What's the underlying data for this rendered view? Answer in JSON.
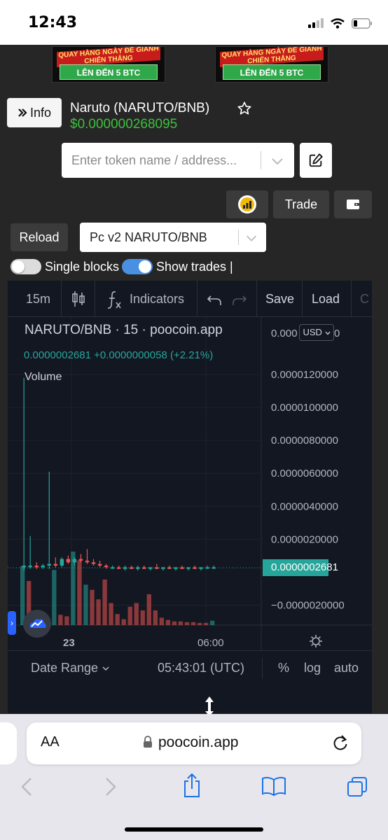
{
  "status_bar": {
    "time": "12:43"
  },
  "banners": [
    {
      "top_text": "QUAY HÀNG NGÀY ĐỂ GIÀNH CHIẾN THẮNG",
      "bottom_text": "LÊN ĐẾN 5 BTC"
    },
    {
      "top_text": "QUAY HÀNG NGÀY ĐỂ GIÀNH CHIẾN THẮNG",
      "bottom_text": "LÊN ĐẾN 5 BTC"
    }
  ],
  "header": {
    "info_label": "Info",
    "token_title": "Naruto (NARUTO/BNB)",
    "token_price": "$0.000000268095"
  },
  "search": {
    "placeholder": "Enter token name / address..."
  },
  "actions": {
    "trade_label": "Trade",
    "reload_label": "Reload"
  },
  "pair_select": {
    "value": "Pc v2 NARUTO/BNB"
  },
  "toggles": [
    {
      "label": "Single blocks",
      "on": false
    },
    {
      "label": "Show trades |",
      "on": true
    }
  ],
  "chart_toolbar": {
    "interval": "15m",
    "indicators_label": "Indicators",
    "save_label": "Save",
    "load_label": "Load",
    "overflow_label": "C"
  },
  "chart_legend": {
    "title": "NARUTO/BNB · 15 · poocoin.app",
    "ohlc": "0.0000002681  +0.0000000058 (+2.21%)",
    "volume_label": "Volume",
    "currency": "USD",
    "last_price_tag": "0.0000002681"
  },
  "chart_footer": {
    "date_range": "Date Range",
    "time": "05:43:01 (UTC)",
    "percent": "%",
    "log": "log",
    "auto": "auto"
  },
  "browser": {
    "aa_label": "AA",
    "url": "poocoin.app"
  },
  "colors": {
    "up": "#26a69a",
    "down": "#ef5350",
    "price_green": "#3fbf3f",
    "chart_bg": "#131722",
    "toggle_on": "#4a90e2"
  },
  "chart_data": {
    "type": "candlestick",
    "x_tick_labels": [
      "23",
      "06:00"
    ],
    "y_tick_labels": [
      "0.0000120000",
      "0.0000100000",
      "0.0000080000",
      "0.0000060000",
      "0.0000040000",
      "0.0000020000",
      "−0.0000020000"
    ],
    "y_top_label": "0.000",
    "y_top_suffix": "0",
    "ylim": [
      -3e-06,
      1.4e-05
    ],
    "last_price": 2.681e-07,
    "candles": [
      {
        "o": 4e-07,
        "h": 1.18e-05,
        "l": 1e-07,
        "c": 3e-07,
        "up": true
      },
      {
        "o": 3e-07,
        "h": 2.2e-06,
        "l": 2e-07,
        "c": 4e-07,
        "up": true
      },
      {
        "o": 4e-07,
        "h": 6e-07,
        "l": 2e-07,
        "c": 3e-07,
        "up": false
      },
      {
        "o": 3e-07,
        "h": 5e-07,
        "l": 2e-07,
        "c": 4e-07,
        "up": true
      },
      {
        "o": 4e-07,
        "h": 6.1e-06,
        "l": 2e-07,
        "c": 5e-07,
        "up": true
      },
      {
        "o": 5e-07,
        "h": 9e-07,
        "l": 3e-07,
        "c": 4e-07,
        "up": false
      },
      {
        "o": 4e-07,
        "h": 9e-07,
        "l": 3e-07,
        "c": 8e-07,
        "up": true
      },
      {
        "o": 8e-07,
        "h": 1e-06,
        "l": 5e-07,
        "c": 6e-07,
        "up": false
      },
      {
        "o": 6e-07,
        "h": 9e-07,
        "l": 4e-07,
        "c": 8e-07,
        "up": true
      },
      {
        "o": 8e-07,
        "h": 1.1e-06,
        "l": 6e-07,
        "c": 7e-07,
        "up": false
      },
      {
        "o": 7e-07,
        "h": 1.4e-06,
        "l": 5e-07,
        "c": 6e-07,
        "up": false
      },
      {
        "o": 6e-07,
        "h": 8e-07,
        "l": 4e-07,
        "c": 5e-07,
        "up": false
      },
      {
        "o": 5e-07,
        "h": 7e-07,
        "l": 3e-07,
        "c": 4e-07,
        "up": false
      },
      {
        "o": 4e-07,
        "h": 5e-07,
        "l": 2e-07,
        "c": 3e-07,
        "up": false
      },
      {
        "o": 3e-07,
        "h": 4e-07,
        "l": 2e-07,
        "c": 3e-07,
        "up": true
      },
      {
        "o": 3e-07,
        "h": 4e-07,
        "l": 2e-07,
        "c": 2e-07,
        "up": false
      },
      {
        "o": 2e-07,
        "h": 4e-07,
        "l": 1e-07,
        "c": 3e-07,
        "up": true
      },
      {
        "o": 3e-07,
        "h": 4e-07,
        "l": 2e-07,
        "c": 2e-07,
        "up": false
      },
      {
        "o": 2e-07,
        "h": 4e-07,
        "l": 1e-07,
        "c": 3e-07,
        "up": true
      },
      {
        "o": 3e-07,
        "h": 4e-07,
        "l": 2e-07,
        "c": 2e-07,
        "up": false
      },
      {
        "o": 2e-07,
        "h": 3e-07,
        "l": 1e-07,
        "c": 3e-07,
        "up": true
      },
      {
        "o": 3e-07,
        "h": 5e-07,
        "l": 2e-07,
        "c": 2e-07,
        "up": false
      },
      {
        "o": 2e-07,
        "h": 3e-07,
        "l": 1e-07,
        "c": 3e-07,
        "up": true
      },
      {
        "o": 3e-07,
        "h": 4e-07,
        "l": 2e-07,
        "c": 2e-07,
        "up": false
      },
      {
        "o": 2e-07,
        "h": 3e-07,
        "l": 1e-07,
        "c": 3e-07,
        "up": true
      },
      {
        "o": 3e-07,
        "h": 4e-07,
        "l": 2e-07,
        "c": 2e-07,
        "up": false
      },
      {
        "o": 2e-07,
        "h": 3e-07,
        "l": 1e-07,
        "c": 3e-07,
        "up": true
      },
      {
        "o": 3e-07,
        "h": 4e-07,
        "l": 2e-07,
        "c": 2e-07,
        "up": false
      },
      {
        "o": 2e-07,
        "h": 3e-07,
        "l": 1e-07,
        "c": 3e-07,
        "up": true
      },
      {
        "o": 3e-07,
        "h": 4e-07,
        "l": 2e-07,
        "c": 3e-07,
        "up": true
      },
      {
        "o": 3e-07,
        "h": 4e-07,
        "l": 2e-07,
        "c": 3e-07,
        "up": true
      }
    ],
    "volume": [
      {
        "v": 0.8,
        "up": true
      },
      {
        "v": 0.6,
        "up": false
      },
      {
        "v": 0.15,
        "up": false
      },
      {
        "v": 0.12,
        "up": false
      },
      {
        "v": 0.1,
        "up": true
      },
      {
        "v": 0.75,
        "up": true
      },
      {
        "v": 0.14,
        "up": false
      },
      {
        "v": 0.12,
        "up": false
      },
      {
        "v": 1.0,
        "up": true
      },
      {
        "v": 0.88,
        "up": false
      },
      {
        "v": 0.55,
        "up": true
      },
      {
        "v": 0.48,
        "up": false
      },
      {
        "v": 0.35,
        "up": false
      },
      {
        "v": 0.62,
        "up": false
      },
      {
        "v": 0.3,
        "up": false
      },
      {
        "v": 0.15,
        "up": false
      },
      {
        "v": 0.08,
        "up": false
      },
      {
        "v": 0.25,
        "up": false
      },
      {
        "v": 0.3,
        "up": false
      },
      {
        "v": 0.2,
        "up": false
      },
      {
        "v": 0.42,
        "up": false
      },
      {
        "v": 0.2,
        "up": false
      },
      {
        "v": 0.1,
        "up": false
      },
      {
        "v": 0.07,
        "up": false
      },
      {
        "v": 0.05,
        "up": false
      },
      {
        "v": 0.05,
        "up": false
      },
      {
        "v": 0.04,
        "up": false
      },
      {
        "v": 0.04,
        "up": false
      },
      {
        "v": 0.03,
        "up": false
      },
      {
        "v": 0.03,
        "up": false
      },
      {
        "v": 0.06,
        "up": true
      }
    ]
  }
}
